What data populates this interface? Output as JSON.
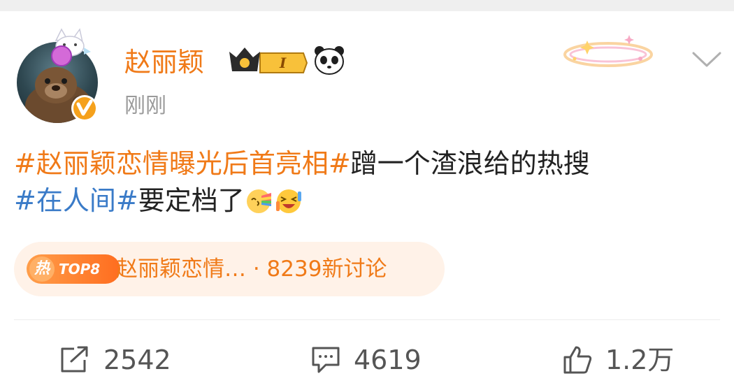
{
  "header": {
    "username": "赵丽颖",
    "vip_level": "I",
    "time": "刚刚"
  },
  "post": {
    "topic1": "#赵丽颖恋情曝光后首亮相#",
    "text1": "蹭一个渣浪给的热搜",
    "topic2": "#在人间#",
    "text2": "要定档了"
  },
  "hot": {
    "badge_char": "热",
    "badge_rank": "TOP8",
    "text": "赵丽颖恋情… · 8239新讨论"
  },
  "actions": {
    "repost_count": "2542",
    "comment_count": "4619",
    "like_count": "1.2万"
  },
  "colors": {
    "username": "#f07a18",
    "topic_orange": "#f07a18",
    "topic_blue": "#3a7bc8",
    "hot_bg": "#fff2e8"
  }
}
